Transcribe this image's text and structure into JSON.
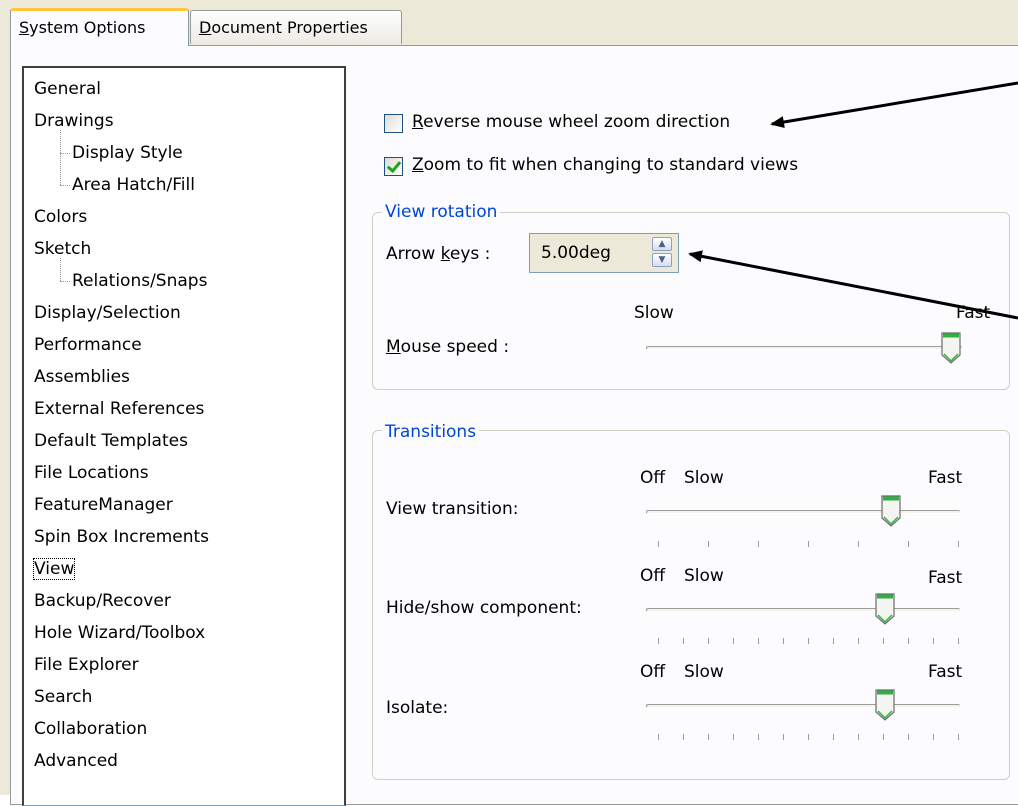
{
  "tabs": {
    "system_options": "System Options",
    "system_options_accel": "S",
    "system_options_rest": "ystem Options",
    "document_properties_accel": "D",
    "document_properties_rest": "ocument Properties"
  },
  "tree": {
    "items": [
      "General",
      "Drawings",
      "Display Style",
      "Area Hatch/Fill",
      "Colors",
      "Sketch",
      "Relations/Snaps",
      "Display/Selection",
      "Performance",
      "Assemblies",
      "External References",
      "Default Templates",
      "File Locations",
      "FeatureManager",
      "Spin Box Increments",
      "View",
      "Backup/Recover",
      "Hole Wizard/Toolbox",
      "File Explorer",
      "Search",
      "Collaboration",
      "Advanced"
    ],
    "selected": "View"
  },
  "options": {
    "reverse_zoom_accel": "R",
    "reverse_zoom_rest": "everse mouse wheel zoom direction",
    "reverse_zoom_checked": false,
    "zoom_to_fit_accel": "Z",
    "zoom_to_fit_rest": "oom to fit when changing to standard views",
    "zoom_to_fit_checked": true
  },
  "view_rotation": {
    "title": "View rotation",
    "arrow_keys_pre": "Arrow ",
    "arrow_keys_accel": "k",
    "arrow_keys_post": "eys :",
    "arrow_keys_value": "5.00deg",
    "mouse_speed_accel": "M",
    "mouse_speed_rest": "ouse speed :",
    "slow": "Slow",
    "fast": "Fast",
    "mouse_speed_level": 1.0
  },
  "transitions": {
    "title": "Transitions",
    "off": "Off",
    "slow": "Slow",
    "fast": "Fast",
    "view_transition_label": "View transition:",
    "view_transition_level": 0.8,
    "hide_show_label": "Hide/show component:",
    "hide_show_level": 0.78,
    "isolate_label": "Isolate:",
    "isolate_level": 0.78
  },
  "colors": {
    "group_title": "#0046d5",
    "checkmark": "#21a121",
    "thumb": "#2fb040"
  },
  "icons": [
    "spin-up-icon",
    "spin-down-icon",
    "checkmark-icon",
    "annotation-arrow-icon"
  ]
}
